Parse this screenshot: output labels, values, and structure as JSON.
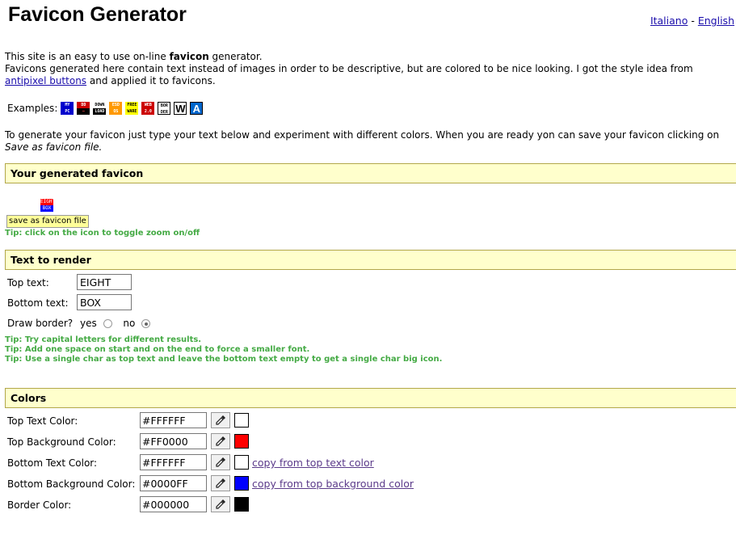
{
  "header": {
    "title": "Favicon Generator",
    "lang_italiano": "Italiano",
    "lang_sep": "-",
    "lang_english": "English"
  },
  "intro": {
    "line1_pre": "This site is an easy to use on-line ",
    "line1_bold": "favicon",
    "line1_post": " generator.",
    "line2": "Favicons generated here contain text instead of images in order to be descriptive, but are colored to be nice looking. I got the style idea from",
    "link": "antipixel buttons",
    "line3_post": " and applied it to favicons."
  },
  "examples": {
    "label": "Examples:",
    "icons": [
      {
        "top": "MY",
        "bottom": "PC",
        "top_bg": "#0000cc",
        "top_fg": "#ffffff",
        "bottom_bg": "#0000cc",
        "bottom_fg": "#ffffff"
      },
      {
        "top": "DD",
        "bottom": "—",
        "top_bg": "#cc0000",
        "top_fg": "#ffffff",
        "bottom_bg": "#000000",
        "bottom_fg": "#ff4444"
      },
      {
        "top": "DOWN",
        "bottom": "LOAD",
        "top_bg": "#ffffff",
        "top_fg": "#000000",
        "bottom_bg": "#000000",
        "bottom_fg": "#ffffff"
      },
      {
        "top": "ESD",
        "bottom": "OS",
        "top_bg": "#ff9900",
        "top_fg": "#ffffff",
        "bottom_bg": "#ff9900",
        "bottom_fg": "#ffffff"
      },
      {
        "top": "FREE",
        "bottom": "WARE",
        "top_bg": "#ffff00",
        "top_fg": "#000000",
        "bottom_bg": "#ffff00",
        "bottom_fg": "#000000"
      },
      {
        "top": "WEB",
        "bottom": "2.0",
        "top_bg": "#cc0000",
        "top_fg": "#ffffff",
        "bottom_bg": "#cc0000",
        "bottom_fg": "#ffffff"
      },
      {
        "top": "BOR",
        "bottom": "DER",
        "top_bg": "#ffffff",
        "top_fg": "#000000",
        "bottom_bg": "#ffffff",
        "bottom_fg": "#000000"
      },
      {
        "big": "W",
        "bg": "#ffffff",
        "fg": "#000000"
      },
      {
        "big": "A",
        "bg": "#0066cc",
        "fg": "#ffffff"
      }
    ]
  },
  "generate_text": {
    "line1": "To generate your favicon just type your text below and experiment with different colors. When you are ready yon can save your favicon clicking on",
    "line2": "Save as favicon file."
  },
  "sections": {
    "generated": "Your generated favicon",
    "text": "Text to render",
    "colors": "Colors"
  },
  "preview": {
    "top": "EIGHT",
    "bottom": "BOX",
    "save_button": "save as favicon file",
    "tip": "Tip: click on the icon to toggle zoom on/off"
  },
  "text_form": {
    "top_label": "Top text:",
    "top_value": "EIGHT",
    "bottom_label": "Bottom text:",
    "bottom_value": "BOX",
    "border_label": "Draw border?",
    "yes_label": "yes",
    "no_label": "no",
    "border_selected": "no",
    "tips": [
      "Tip: Try capital letters for different results.",
      "Tip: Add one space on start and on the end to force a smaller font.",
      "Tip: Use a single char as top text and leave the bottom text empty to get a single char big icon."
    ]
  },
  "colors": [
    {
      "label": "Top Text Color:",
      "value": "#FFFFFF",
      "swatch": "#ffffff",
      "link": ""
    },
    {
      "label": "Top Background Color:",
      "value": "#FF0000",
      "swatch": "#ff0000",
      "link": ""
    },
    {
      "label": "Bottom Text Color:",
      "value": "#FFFFFF",
      "swatch": "#ffffff",
      "link": "copy from top text color"
    },
    {
      "label": "Bottom Background Color:",
      "value": "#0000FF",
      "swatch": "#0000ff",
      "link": "copy from top background color"
    },
    {
      "label": "Border Color:",
      "value": "#000000",
      "swatch": "#000000",
      "link": ""
    }
  ],
  "icons": {
    "picker": "eyedropper-icon"
  }
}
